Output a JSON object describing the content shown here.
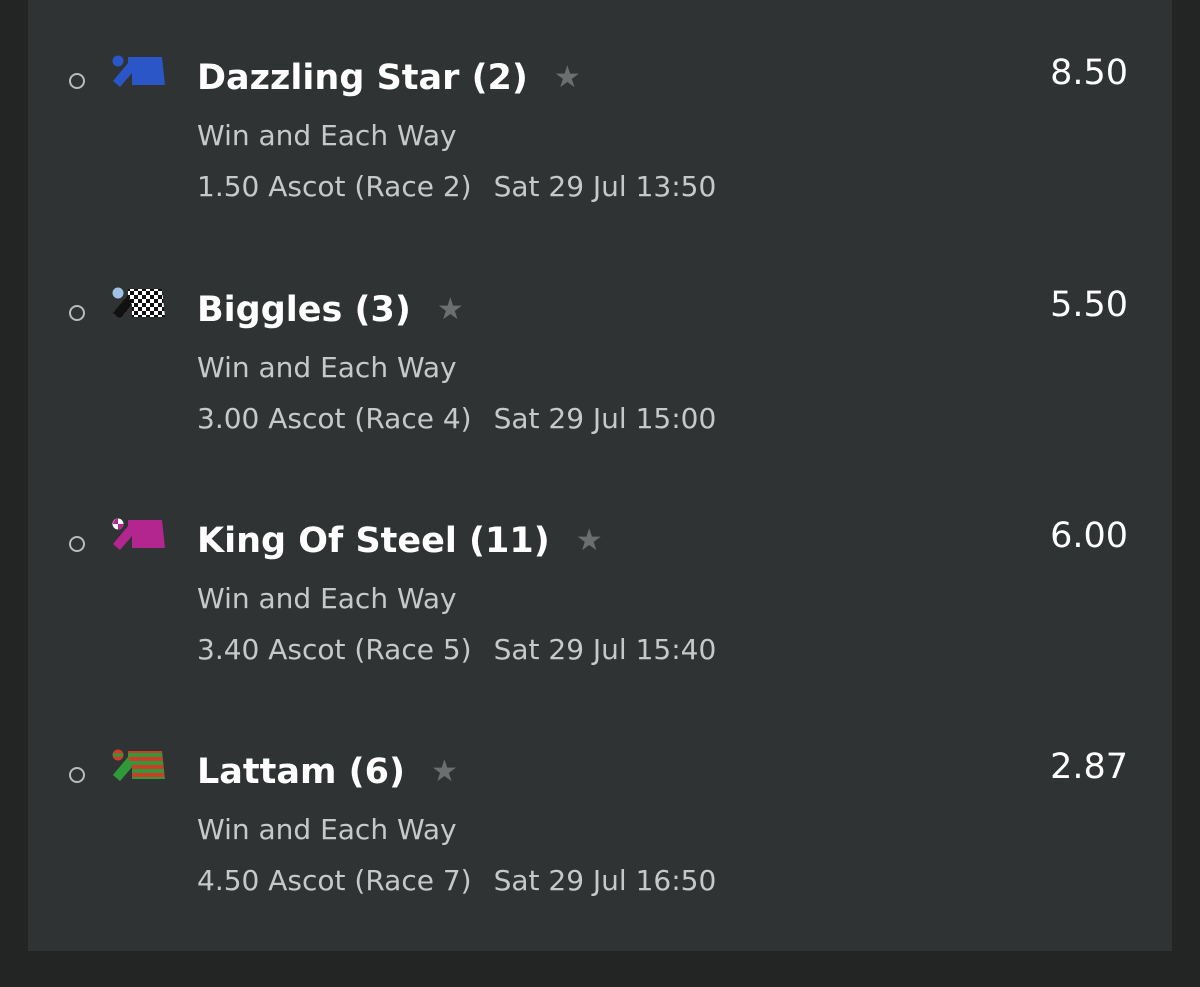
{
  "selections": [
    {
      "name": "Dazzling Star (2)",
      "odds": "8.50",
      "market": "Win and Each Way",
      "race": "1.50 Ascot (Race 2)",
      "datetime": "Sat 29 Jul 13:50",
      "silk_icon": "jockey-silk-blue"
    },
    {
      "name": "Biggles (3)",
      "odds": "5.50",
      "market": "Win and Each Way",
      "race": "3.00 Ascot (Race 4)",
      "datetime": "Sat 29 Jul 15:00",
      "silk_icon": "jockey-silk-black-white-check"
    },
    {
      "name": "King Of Steel (11)",
      "odds": "6.00",
      "market": "Win and Each Way",
      "race": "3.40 Ascot (Race 5)",
      "datetime": "Sat 29 Jul 15:40",
      "silk_icon": "jockey-silk-magenta"
    },
    {
      "name": "Lattam (6)",
      "odds": "2.87",
      "market": "Win and Each Way",
      "race": "4.50 Ascot (Race 7)",
      "datetime": "Sat 29 Jul 16:50",
      "silk_icon": "jockey-silk-red-green-hoops"
    }
  ],
  "icons": {
    "star": "★",
    "radio": "radio-unchecked"
  },
  "colors": {
    "background": "#232525",
    "panel": "#303333",
    "text_primary": "#ffffff",
    "text_secondary": "#c6c9c9",
    "star": "#6b6f6f"
  }
}
